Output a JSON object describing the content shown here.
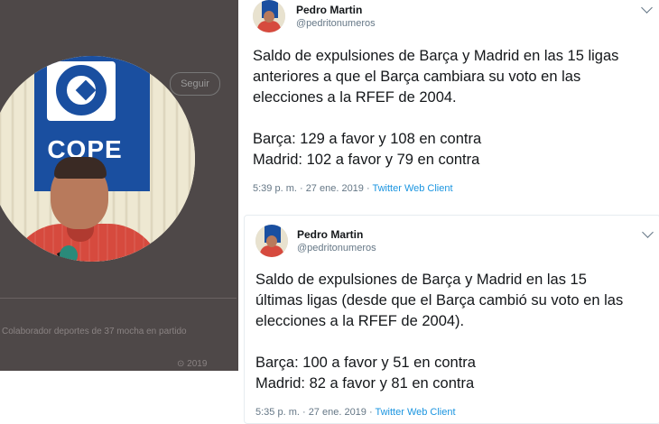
{
  "left_panel": {
    "ghost_follow_label": "Seguir",
    "ghost_caption": "Colaborador deportes de 37 mocha en partido",
    "ghost_caption2": "⊙ 2019",
    "photo_banner_text": "COPE"
  },
  "tweets": [
    {
      "name": "Pedro Martin",
      "handle": "@pedritonumeros",
      "text": "Saldo de expulsiones de Barça y Madrid en las 15 ligas\nanteriores a que el Barça cambiara su voto en las\nelecciones a la RFEF de 2004.\n\nBarça: 129 a favor y 108 en contra\nMadrid: 102 a favor y 79 en contra",
      "timestamp": "5:39 p. m. · 27 ene. 2019 · ",
      "client": "Twitter Web Client"
    },
    {
      "name": "Pedro Martin",
      "handle": "@pedritonumeros",
      "text": "Saldo de expulsiones de Barça y Madrid en las 15\núltimas ligas (desde que el Barça cambió su voto en las\nelecciones a la RFEF de 2004).\n\nBarça: 100 a favor y 51 en contra\nMadrid: 82 a favor y 81 en contra",
      "timestamp": "5:35 p. m. · 27 ene. 2019 · ",
      "client": "Twitter Web Client"
    }
  ],
  "colors": {
    "link_blue": "#1b95e0",
    "meta_gray": "#657786",
    "text_dark": "#14171a"
  }
}
